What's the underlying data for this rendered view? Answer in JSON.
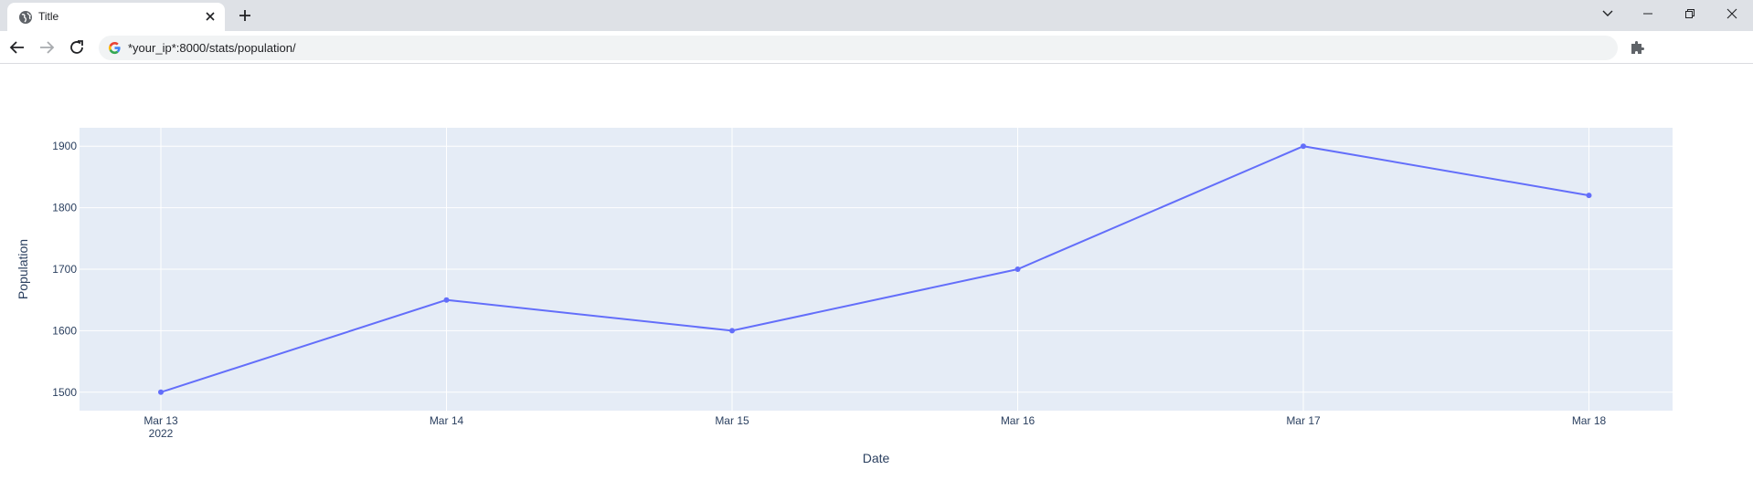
{
  "browser": {
    "tab_title": "Title",
    "url": "*your_ip*:8000/stats/population/",
    "icons": [
      "globe-icon",
      "close-icon",
      "plus-icon",
      "chevron-down-icon",
      "minimize-icon",
      "restore-icon",
      "window-close-icon",
      "back-arrow-icon",
      "forward-arrow-icon",
      "reload-icon",
      "google-g-icon",
      "puzzle-icon"
    ]
  },
  "chart_data": {
    "type": "line",
    "title": "",
    "xlabel": "Date",
    "ylabel": "Population",
    "x": [
      "2022-03-13",
      "2022-03-14",
      "2022-03-15",
      "2022-03-16",
      "2022-03-17",
      "2022-03-18"
    ],
    "x_tick_labels": [
      "Mar 13",
      "Mar 14",
      "Mar 15",
      "Mar 16",
      "Mar 17",
      "Mar 18"
    ],
    "x_year_label": "2022",
    "series": [
      {
        "values": [
          1500,
          1650,
          1600,
          1700,
          1900,
          1820
        ],
        "color": "#636efa"
      }
    ],
    "ylim": [
      1470,
      1930
    ],
    "y_ticks": [
      1500,
      1600,
      1700,
      1800,
      1900
    ],
    "grid": true,
    "plot_background": "#e5ecf6",
    "mode": "lines+markers"
  }
}
